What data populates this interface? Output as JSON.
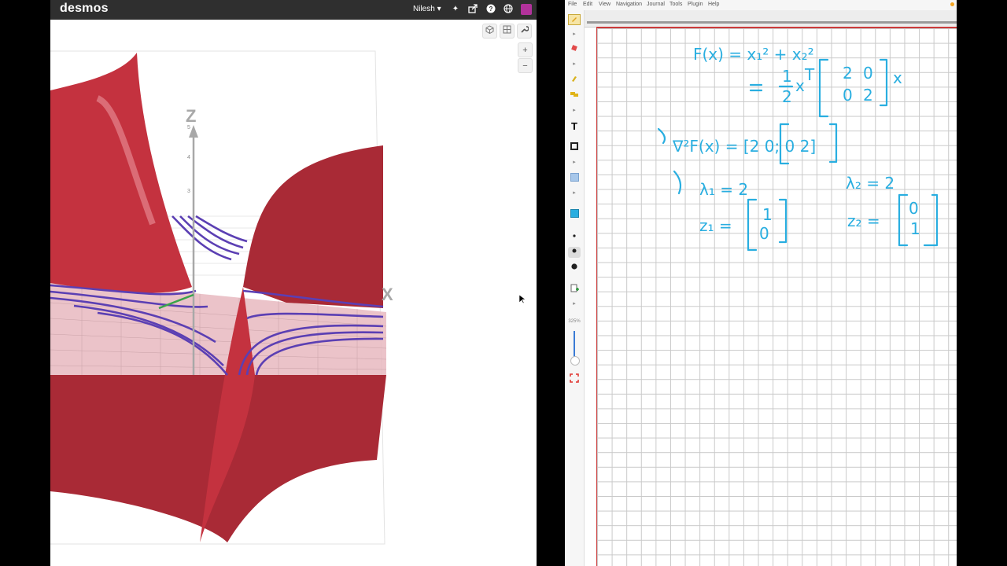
{
  "desmos": {
    "logo": "desmos",
    "user": "Nilesh",
    "zoom_in_label": "+",
    "zoom_out_label": "−",
    "graph": {
      "axis_z_label": "Z",
      "axis_x_label": "X",
      "z_ticks": [
        "5",
        "4",
        "3"
      ]
    },
    "colors": {
      "surface": "#c4323f",
      "contours": "#5b3fb3",
      "header": "#2f2f2f"
    }
  },
  "journal": {
    "menu": [
      "File",
      "Edit",
      "View",
      "Navigation",
      "Journal",
      "Tools",
      "Plugin",
      "Help"
    ],
    "zoom_level": "325%",
    "ink_color": "#29aee0",
    "notes": {
      "line1": "F(x) = x₁² + x₂²",
      "line2": "= ½ xᵀ [2 0; 0 2] x",
      "line3": "∇²F(x) = [2 0; 0 2]",
      "line4a": "λ₁ = 2",
      "line4b": "λ₂ = 2",
      "line5a": "z₁ = [1; 0]",
      "line5b": "z₂ = [0; 1]"
    }
  }
}
